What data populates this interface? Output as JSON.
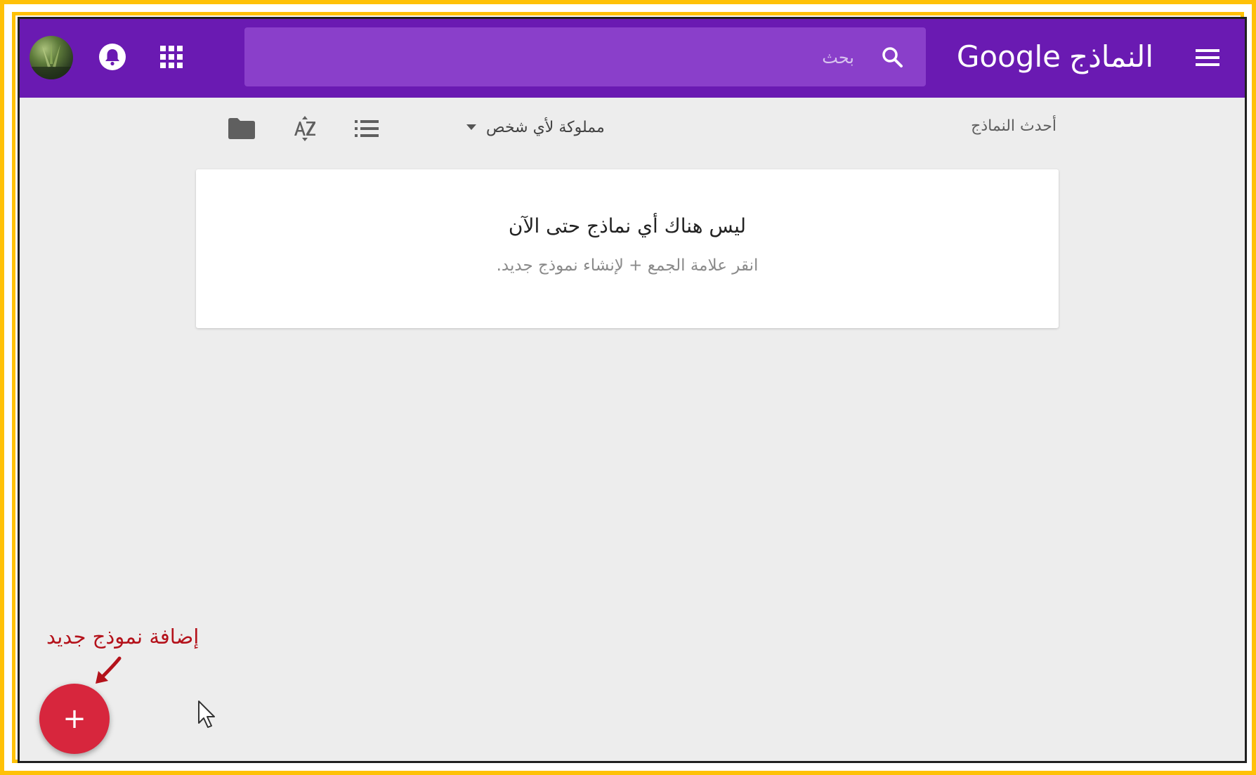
{
  "app": {
    "title_ar": "النماذج",
    "title_brand": "Google",
    "accent_color": "#6a1ab2",
    "icons": {
      "menu": "menu-icon",
      "search": "search-icon",
      "apps": "apps-grid-icon",
      "notifications": "notifications-icon",
      "avatar": "avatar"
    }
  },
  "search": {
    "placeholder": "بحث",
    "value": ""
  },
  "toolbar": {
    "section_title": "أحدث النماذج",
    "owner_filter": "مملوكة لأي شخص",
    "icons": [
      "list-view-icon",
      "sort-az-icon",
      "folder-icon"
    ]
  },
  "empty_state": {
    "title": "ليس هناك أي نماذج حتى الآن",
    "subtitle": "انقر علامة الجمع + لإنشاء نموذج جديد."
  },
  "annotation": {
    "label": "إضافة نموذج جديد",
    "color": "#b4121b"
  },
  "fab": {
    "symbol": "+",
    "color": "#d7263d"
  }
}
